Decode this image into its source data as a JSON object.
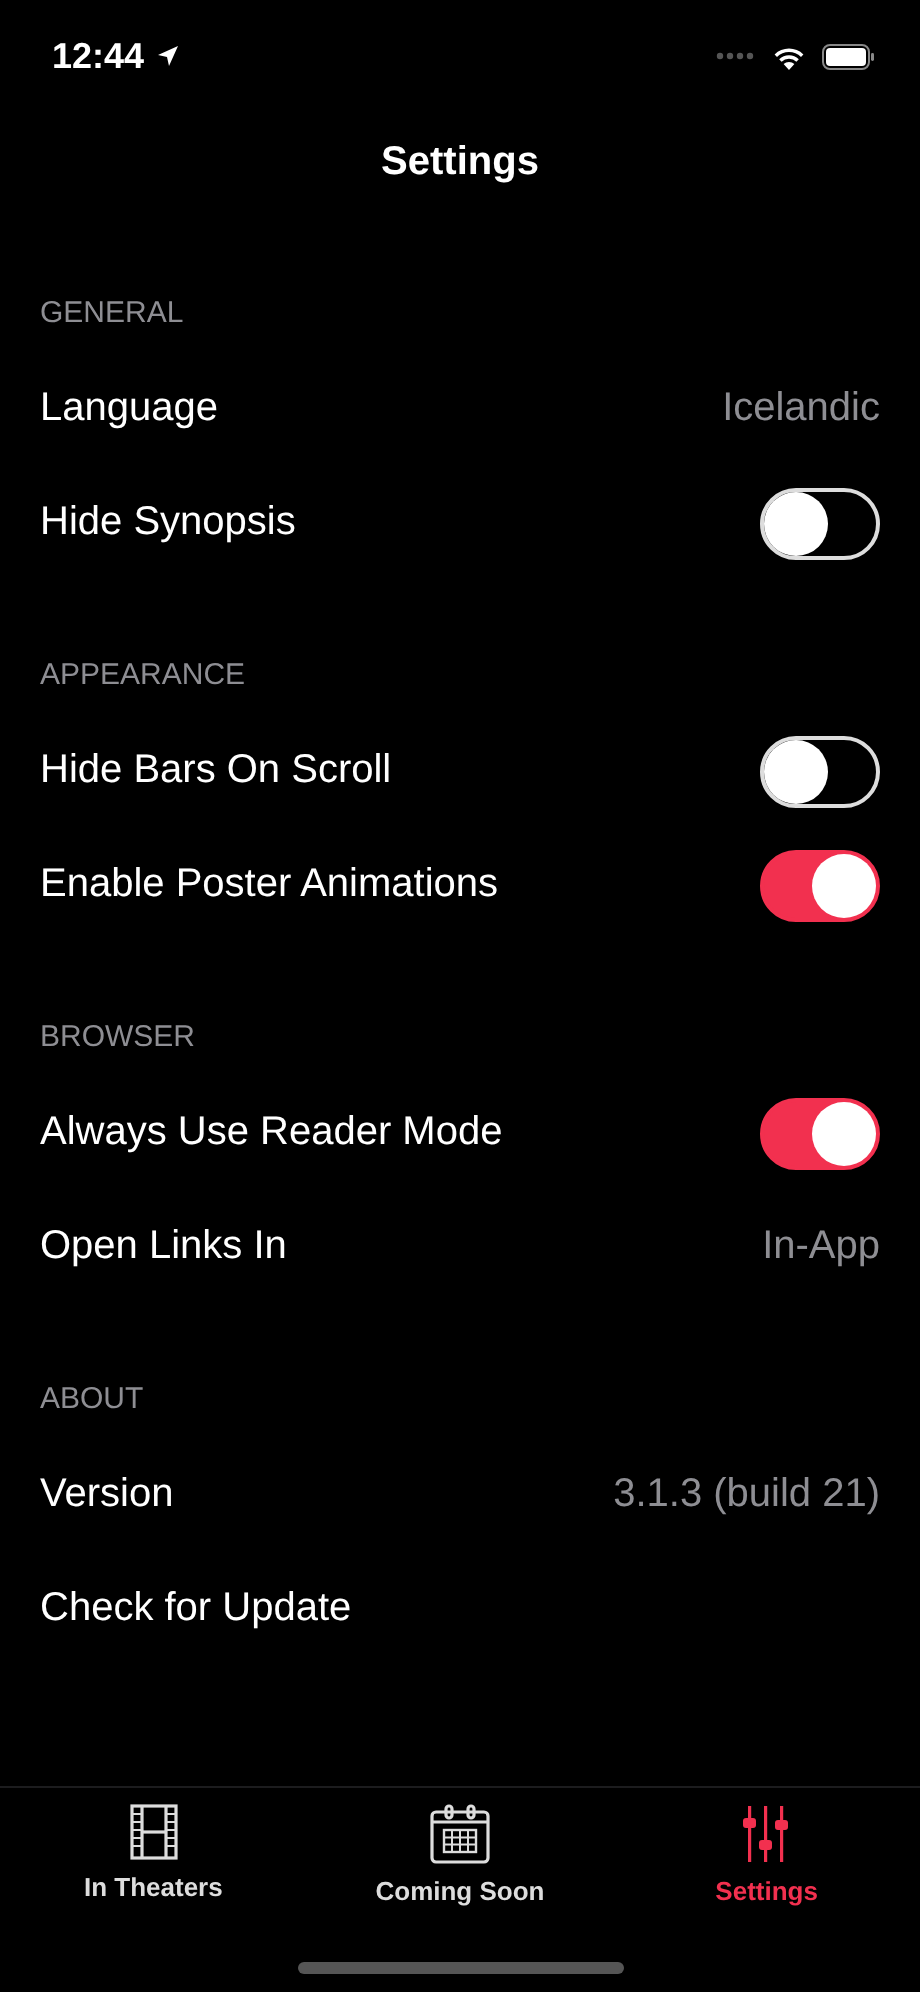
{
  "status_bar": {
    "time": "12:44"
  },
  "title": "Settings",
  "sections": [
    {
      "header": "GENERAL",
      "rows": [
        {
          "kind": "value",
          "label": "Language",
          "value": "Icelandic"
        },
        {
          "kind": "toggle",
          "label": "Hide Synopsis",
          "on": false
        }
      ]
    },
    {
      "header": "APPEARANCE",
      "rows": [
        {
          "kind": "toggle",
          "label": "Hide Bars On Scroll",
          "on": false
        },
        {
          "kind": "toggle",
          "label": "Enable Poster Animations",
          "on": true
        }
      ]
    },
    {
      "header": "BROWSER",
      "rows": [
        {
          "kind": "toggle",
          "label": "Always Use Reader Mode",
          "on": true
        },
        {
          "kind": "value",
          "label": "Open Links In",
          "value": "In-App"
        }
      ]
    },
    {
      "header": "ABOUT",
      "rows": [
        {
          "kind": "value",
          "label": "Version",
          "value": "3.1.3 (build 21)"
        },
        {
          "kind": "plain",
          "label": "Check for Update"
        }
      ]
    }
  ],
  "tabs": [
    {
      "kind": "film",
      "label": "In Theaters",
      "selected": false
    },
    {
      "kind": "calendar",
      "label": "Coming Soon",
      "selected": false
    },
    {
      "kind": "sliders",
      "label": "Settings",
      "selected": true
    }
  ]
}
